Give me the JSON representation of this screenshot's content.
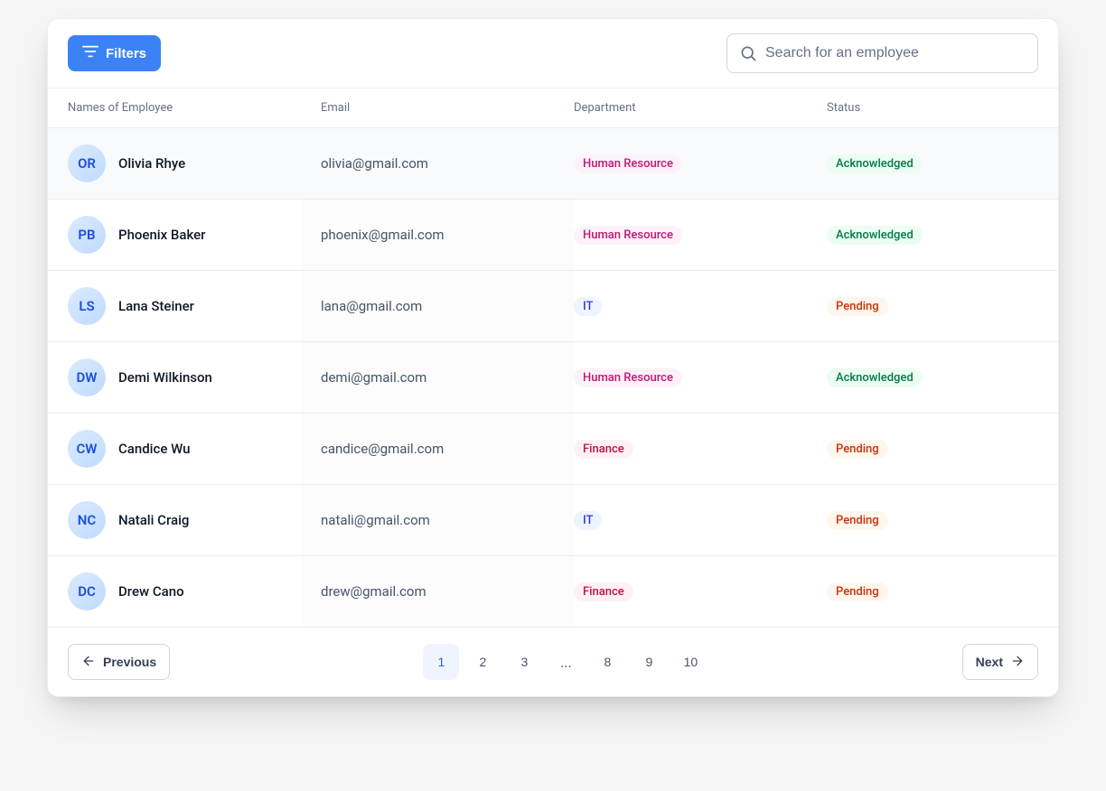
{
  "toolbar": {
    "filters_label": "Filters",
    "search_placeholder": "Search for an employee"
  },
  "columns": {
    "name": "Names of Employee",
    "email": "Email",
    "department": "Department",
    "status": "Status"
  },
  "rows": [
    {
      "name": "Olivia Rhye",
      "initials": "OR",
      "email": "olivia@gmail.com",
      "department": "Human Resource",
      "dept_style": "pink",
      "status": "Acknowledged",
      "status_style": "green",
      "selected": true
    },
    {
      "name": "Phoenix Baker",
      "initials": "PB",
      "email": "phoenix@gmail.com",
      "department": "Human Resource",
      "dept_style": "pink",
      "status": "Acknowledged",
      "status_style": "green",
      "selected": false
    },
    {
      "name": "Lana Steiner",
      "initials": "LS",
      "email": "lana@gmail.com",
      "department": "IT",
      "dept_style": "indigo",
      "status": "Pending",
      "status_style": "orange",
      "selected": false
    },
    {
      "name": "Demi Wilkinson",
      "initials": "DW",
      "email": "demi@gmail.com",
      "department": "Human Resource",
      "dept_style": "pink",
      "status": "Acknowledged",
      "status_style": "green",
      "selected": false
    },
    {
      "name": "Candice Wu",
      "initials": "CW",
      "email": "candice@gmail.com",
      "department": "Finance",
      "dept_style": "rose",
      "status": "Pending",
      "status_style": "orange",
      "selected": false
    },
    {
      "name": "Natali Craig",
      "initials": "NC",
      "email": "natali@gmail.com",
      "department": "IT",
      "dept_style": "indigo",
      "status": "Pending",
      "status_style": "orange",
      "selected": false
    },
    {
      "name": "Drew Cano",
      "initials": "DC",
      "email": "drew@gmail.com",
      "department": "Finance",
      "dept_style": "rose",
      "status": "Pending",
      "status_style": "orange",
      "selected": false
    }
  ],
  "pagination": {
    "previous_label": "Previous",
    "next_label": "Next",
    "pages": [
      "1",
      "2",
      "3",
      "...",
      "8",
      "9",
      "10"
    ],
    "active": "1"
  }
}
